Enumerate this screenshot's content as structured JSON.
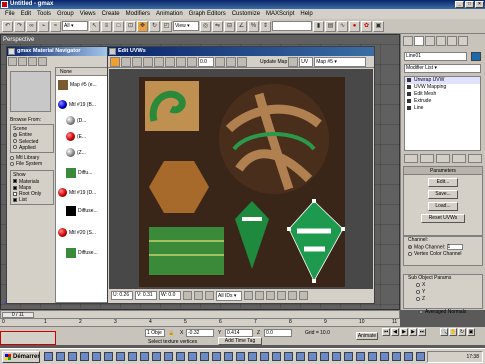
{
  "window": {
    "title": "Untitled - gmax"
  },
  "menu": [
    "File",
    "Edit",
    "Tools",
    "Group",
    "Views",
    "Create",
    "Modifiers",
    "Animation",
    "Graph Editors",
    "Customize",
    "MAXScript",
    "Help"
  ],
  "toolbar": {
    "view_dropdown": "View",
    "selection_dropdown": ""
  },
  "viewport": {
    "label": "Perspective"
  },
  "material_navigator": {
    "title": "gmax Material Navigator",
    "list_header": "None",
    "items": [
      {
        "label": "Map #5 (e..."
      },
      {
        "label": "Mtl #19 (B..."
      },
      {
        "label": "(D..."
      },
      {
        "label": "(E..."
      },
      {
        "label": "(Z..."
      },
      {
        "label": "Diffu..."
      },
      {
        "label": "Mtl #19 (D..."
      },
      {
        "label": "Diffuse..."
      },
      {
        "label": "Mtl #20 (S..."
      },
      {
        "label": "Diffuse..."
      }
    ],
    "browse_from": {
      "title": "Browse From:",
      "scene_title": "Scene",
      "options": [
        "Entire",
        "Selected",
        "Applied"
      ],
      "library_options": [
        "Mtl Library",
        "File System"
      ]
    },
    "show": {
      "title": "Show",
      "options": [
        {
          "label": "Materials",
          "checked": true
        },
        {
          "label": "Maps",
          "checked": true
        },
        {
          "label": "Root Only",
          "checked": false
        },
        {
          "label": "List",
          "checked": true
        }
      ]
    }
  },
  "uvw_editor": {
    "title": "Edit UVWs",
    "spinner_value": "0.0",
    "update_map_label": "Update Map",
    "uv_dropdown": "UV",
    "map_dropdown": "Map #5",
    "bottom": {
      "u": "U: 0.26",
      "v": "V: 0.31",
      "w": "W: 0.0",
      "all_ids": "All IDs"
    }
  },
  "command_panel": {
    "object_name": "Line01",
    "modifier_list": "Modifier List",
    "stack": [
      "Unwrap UVW",
      "UVW Mapping",
      "Edit Mesh",
      "Extrude",
      "Line"
    ],
    "parameters_rollout": {
      "title": "Parameters",
      "buttons": [
        "Edit...",
        "Save...",
        "Load...",
        "Reset UVWs"
      ]
    },
    "channel": {
      "title": "Channel:",
      "map_channel_label": "Map Channel:",
      "map_channel_value": "1",
      "vertex_color_label": "Vertex Color Channel"
    },
    "sub_object_params": {
      "title": "Sub Object Params",
      "axes": [
        "X",
        "Y",
        "Z"
      ],
      "averaged_normals": "Averaged Normals"
    }
  },
  "timeline": {
    "slider": "0 / 11",
    "ticks": [
      "0",
      "1",
      "2",
      "3",
      "4",
      "5",
      "6",
      "7",
      "8",
      "9",
      "10",
      "11"
    ]
  },
  "status": {
    "selection": "1 Obje",
    "x_value": "-0.32",
    "y_value": "0.414",
    "z_value": "0.0",
    "grid": "Grid = 10.0",
    "prompt": "Select texture vertices",
    "add_time_tag": "Add Time Tag",
    "animate": "Animate"
  },
  "taskbar": {
    "start_label": "Démarrer",
    "clock": "17:38"
  }
}
